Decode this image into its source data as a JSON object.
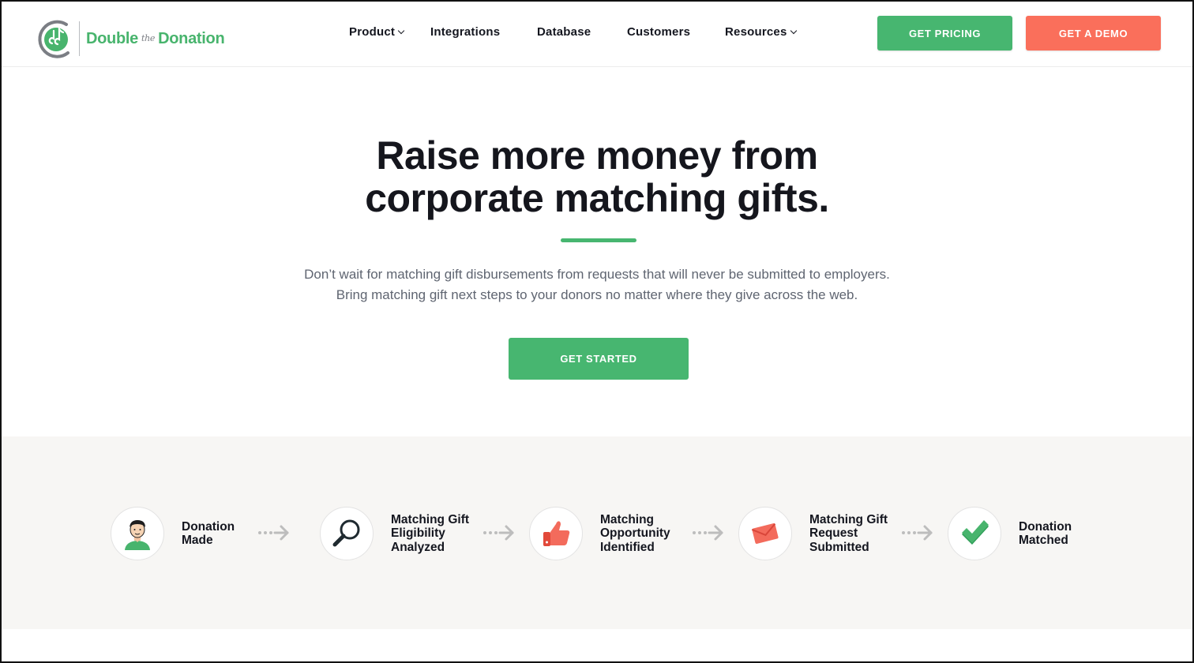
{
  "brand": {
    "name_part1": "Double",
    "name_part2": "the",
    "name_part3": "Donation",
    "logo_icon": "double-the-donation-logo-icon"
  },
  "nav": {
    "items": [
      {
        "label": "Product",
        "has_dropdown": true
      },
      {
        "label": "Integrations",
        "has_dropdown": false
      },
      {
        "label": "Database",
        "has_dropdown": false
      },
      {
        "label": "Customers",
        "has_dropdown": false
      },
      {
        "label": "Resources",
        "has_dropdown": true
      }
    ]
  },
  "header_actions": {
    "pricing_label": "GET PRICING",
    "demo_label": "GET A DEMO"
  },
  "hero": {
    "title_line1": "Raise more money from",
    "title_line2": "corporate matching gifts.",
    "subtitle_line1": "Don’t wait for matching gift disbursements from requests that will never be submitted to employers.",
    "subtitle_line2": "Bring matching gift next steps to your donors no matter where they give across the web.",
    "cta_label": "GET STARTED"
  },
  "process": {
    "steps": [
      {
        "label": "Donation\nMade",
        "icon": "donor-avatar-icon"
      },
      {
        "label": "Matching Gift\nEligibility\nAnalyzed",
        "icon": "magnifying-glass-icon"
      },
      {
        "label": "Matching\nOpportunity\nIdentified",
        "icon": "thumbs-up-icon"
      },
      {
        "label": "Matching Gift\nRequest\nSubmitted",
        "icon": "envelope-icon"
      },
      {
        "label": "Donation\nMatched",
        "icon": "checkmark-icon"
      }
    ]
  },
  "colors": {
    "brand_green": "#47b670",
    "accent_coral": "#fa6f5b",
    "text_dark": "#14161f",
    "text_muted": "#5f6571",
    "band_bg": "#f7f6f4"
  }
}
